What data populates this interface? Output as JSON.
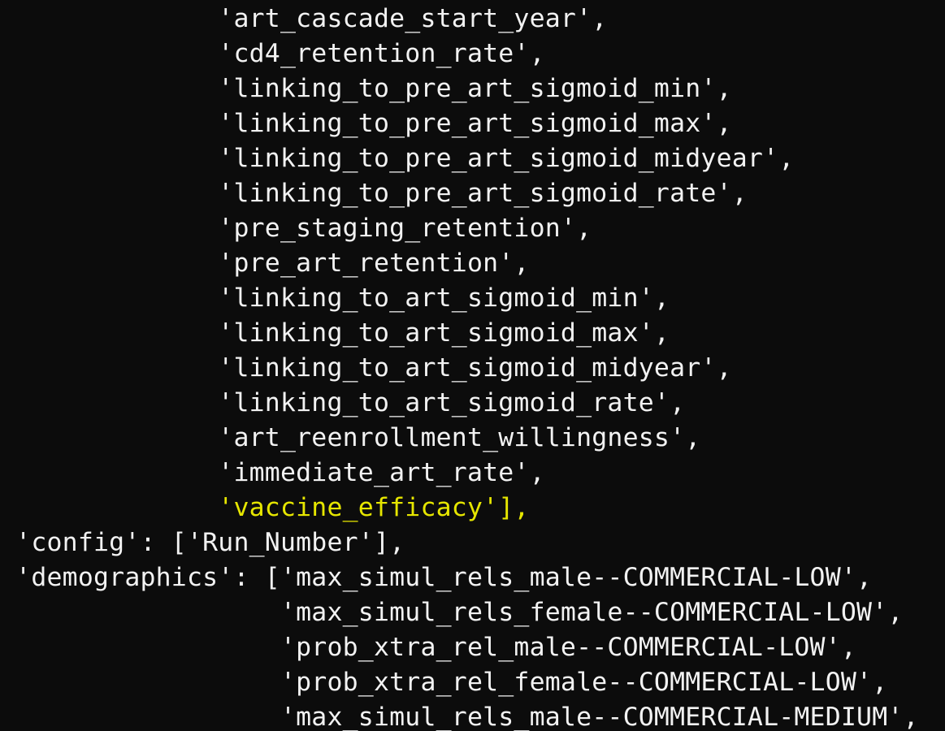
{
  "terminal": {
    "highlight_color": "#e6e600",
    "text_color": "#f2f2f2",
    "background_color": "#0c0c0c",
    "lines": [
      {
        "text": "              'art_cascade_start_year',"
      },
      {
        "text": "              'cd4_retention_rate',"
      },
      {
        "text": "              'linking_to_pre_art_sigmoid_min',"
      },
      {
        "text": "              'linking_to_pre_art_sigmoid_max',"
      },
      {
        "text": "              'linking_to_pre_art_sigmoid_midyear',"
      },
      {
        "text": "              'linking_to_pre_art_sigmoid_rate',"
      },
      {
        "text": "              'pre_staging_retention',"
      },
      {
        "text": "              'pre_art_retention',"
      },
      {
        "text": "              'linking_to_art_sigmoid_min',"
      },
      {
        "text": "              'linking_to_art_sigmoid_max',"
      },
      {
        "text": "              'linking_to_art_sigmoid_midyear',"
      },
      {
        "text": "              'linking_to_art_sigmoid_rate',"
      },
      {
        "text": "              'art_reenrollment_willingness',"
      },
      {
        "text": "              'immediate_art_rate',"
      },
      {
        "text": "              'vaccine_efficacy'],",
        "highlight": true
      },
      {
        "text": " 'config': ['Run_Number'],"
      },
      {
        "text": " 'demographics': ['max_simul_rels_male--COMMERCIAL-LOW',"
      },
      {
        "text": "                  'max_simul_rels_female--COMMERCIAL-LOW',"
      },
      {
        "text": "                  'prob_xtra_rel_male--COMMERCIAL-LOW',"
      },
      {
        "text": "                  'prob_xtra_rel_female--COMMERCIAL-LOW',"
      },
      {
        "text": "                  'max_simul_rels_male--COMMERCIAL-MEDIUM',"
      }
    ]
  }
}
